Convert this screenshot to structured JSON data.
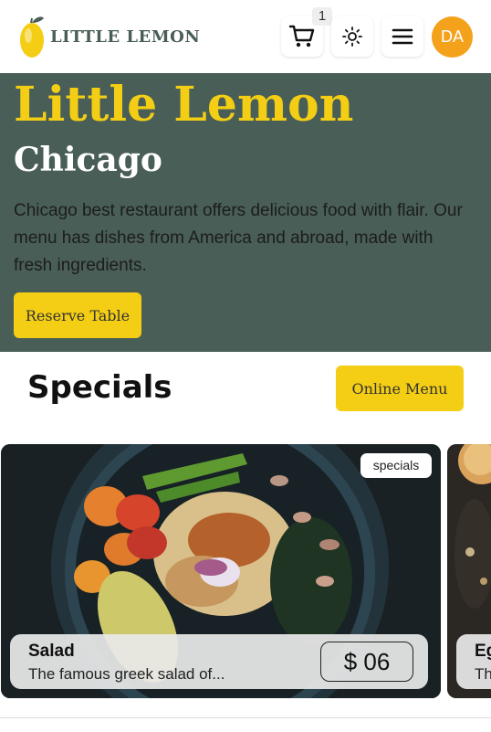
{
  "header": {
    "logo_text": "LITTLE LEMON",
    "cart_count": "1",
    "avatar_initials": "DA"
  },
  "hero": {
    "title": "Little Lemon",
    "subtitle": "Chicago",
    "description": "Chicago best restaurant offers delicious food with flair. Our menu has dishes from America and abroad, made with fresh ingredients.",
    "reserve_label": "Reserve Table"
  },
  "specials": {
    "title": "Specials",
    "online_menu_label": "Online Menu",
    "cards": [
      {
        "tag": "specials",
        "name": "Salad",
        "description": "The famous greek salad of...",
        "price": "$ 06"
      },
      {
        "name": "Eg",
        "description": "Th"
      }
    ]
  },
  "colors": {
    "primary_green": "#495e57",
    "primary_yellow": "#f4ce14",
    "avatar_orange": "#f4a21c"
  },
  "icons": [
    "lemon-logo-icon",
    "cart-icon",
    "sun-icon",
    "hamburger-menu-icon"
  ]
}
